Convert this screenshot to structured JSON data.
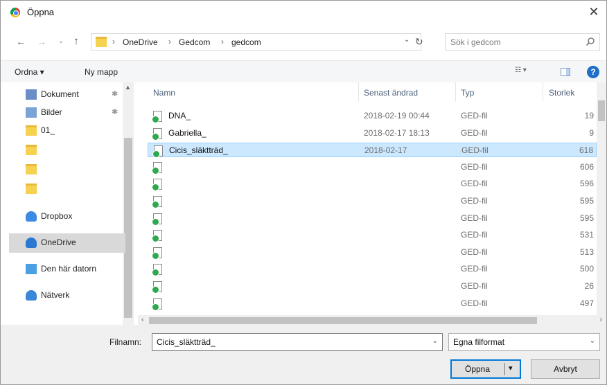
{
  "window": {
    "title": "Öppna",
    "close_glyph": "✕"
  },
  "nav": {
    "back_glyph": "←",
    "forward_glyph": "→",
    "recent_glyph": "⌄",
    "up_glyph": "↑",
    "breadcrumb": [
      "OneDrive",
      "Gedcom",
      "gedcom"
    ],
    "sep_glyph": "›",
    "address_dropdown_glyph": "⌄",
    "refresh_glyph": "↻",
    "search_placeholder": "Sök i gedcom"
  },
  "toolbar": {
    "organize_label": "Ordna ▾",
    "new_folder_label": "Ny mapp",
    "view_glyph": "☷ ▾",
    "help_glyph": "?"
  },
  "sidebar": {
    "items": [
      {
        "label": "Dokument",
        "icon": "documents-icon",
        "pinned": true
      },
      {
        "label": "Bilder",
        "icon": "pictures-icon",
        "pinned": true
      },
      {
        "label": "01_",
        "icon": "folder-sync-icon",
        "pinned": false
      },
      {
        "label": "",
        "icon": "folder-sync-icon",
        "pinned": false
      },
      {
        "label": "",
        "icon": "folder-icon",
        "pinned": false
      },
      {
        "label": "",
        "icon": "folder-sync-icon",
        "pinned": false
      },
      {
        "label": "Dropbox",
        "icon": "dropbox-icon",
        "pinned": false
      },
      {
        "label": "OneDrive",
        "icon": "onedrive-icon",
        "pinned": false,
        "selected": true
      },
      {
        "label": "Den här datorn",
        "icon": "computer-icon",
        "pinned": false
      },
      {
        "label": "Nätverk",
        "icon": "network-icon",
        "pinned": false
      }
    ],
    "pin_glyph": "✱"
  },
  "columns": {
    "name": "Namn",
    "date": "Senast ändrad",
    "type": "Typ",
    "size": "Storlek"
  },
  "files": [
    {
      "name": "DNA_",
      "date": "2018-02-19 00:44",
      "type": "GED-fil",
      "size": "19"
    },
    {
      "name": "Gabriella_",
      "date": "2018-02-17 18:13",
      "type": "GED-fil",
      "size": "9"
    },
    {
      "name": "Cicis_släktträd_",
      "date": "2018-02-17",
      "type": "GED-fil",
      "size": "618",
      "selected": true
    },
    {
      "name": "",
      "date": "",
      "type": "GED-fil",
      "size": "606"
    },
    {
      "name": "",
      "date": "",
      "type": "GED-fil",
      "size": "596"
    },
    {
      "name": "",
      "date": "",
      "type": "GED-fil",
      "size": "595"
    },
    {
      "name": "",
      "date": "",
      "type": "GED-fil",
      "size": "595"
    },
    {
      "name": "",
      "date": "",
      "type": "GED-fil",
      "size": "531"
    },
    {
      "name": "",
      "date": "",
      "type": "GED-fil",
      "size": "513"
    },
    {
      "name": "",
      "date": "",
      "type": "GED-fil",
      "size": "500"
    },
    {
      "name": "",
      "date": "",
      "type": "GED-fil",
      "size": "26"
    },
    {
      "name": "",
      "date": "",
      "type": "GED-fil",
      "size": "497"
    }
  ],
  "footer": {
    "filename_label": "Filnamn:",
    "filename_value": "Cicis_släktträd_",
    "filetype_value": "Egna filformat",
    "open_label": "Öppna",
    "open_arrow": "▾",
    "cancel_label": "Avbryt",
    "dropdown_glyph": "⌄"
  },
  "colors": {
    "accent": "#0078d7",
    "selection": "#cce8ff",
    "selection_border": "#99d1ff",
    "sync_green": "#2fa84f"
  }
}
